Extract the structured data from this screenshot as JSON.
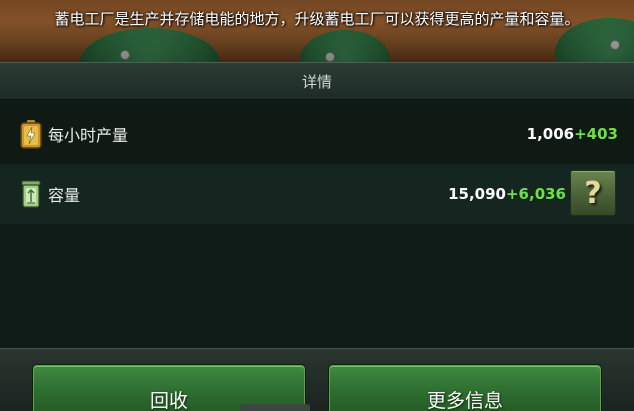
{
  "banner": {
    "description": "蓄电工厂是生产并存储电能的地方，升级蓄电工厂可以获得更高的产量和容量。"
  },
  "section": {
    "title": "详情"
  },
  "stats": [
    {
      "label": "每小时产量",
      "value": "1,006",
      "bonus": "+403",
      "icon": "battery-icon"
    },
    {
      "label": "容量",
      "value": "15,090",
      "bonus": "+6,036",
      "icon": "storage-icon"
    }
  ],
  "help_button": {
    "label": "?"
  },
  "buttons": {
    "recycle": "回收",
    "more_info": "更多信息"
  },
  "colors": {
    "bonus_green": "#6ee04a",
    "button_green": "#2e6e30"
  }
}
